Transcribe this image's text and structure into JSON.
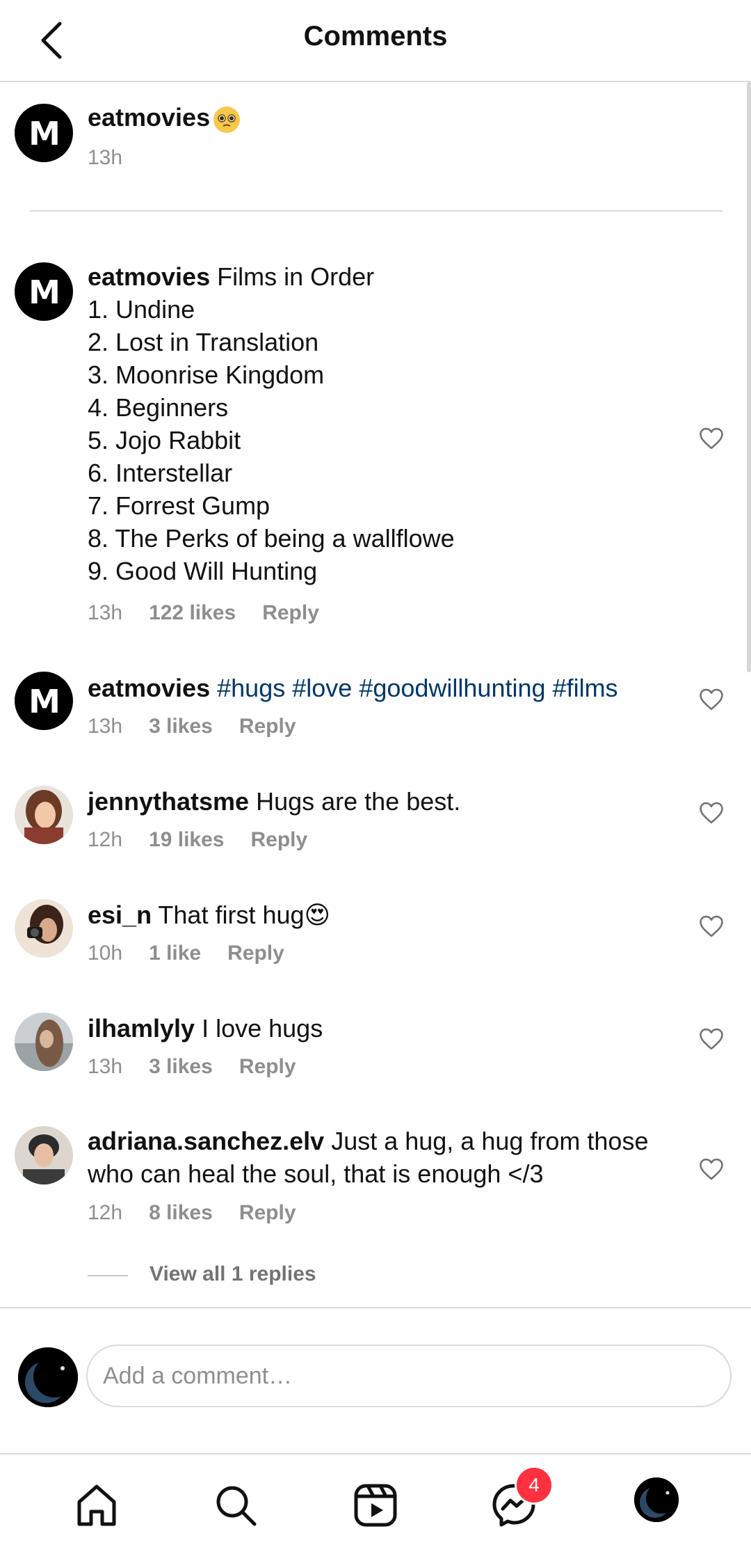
{
  "header": {
    "title": "Comments"
  },
  "caption": {
    "username": "eatmovies",
    "emoji": "🥺",
    "time": "13h"
  },
  "comments": [
    {
      "username": "eatmovies",
      "text": "Films in Order",
      "list": [
        "1. Undine",
        "2. Lost in Translation",
        "3. Moonrise Kingdom",
        "4. Beginners",
        "5. Jojo Rabbit",
        "6. Interstellar",
        "7. Forrest Gump",
        "8. The Perks of being a wallflowe",
        "9. Good Will Hunting"
      ],
      "time": "13h",
      "likes": "122 likes",
      "reply": "Reply"
    },
    {
      "username": "eatmovies",
      "hashtags": [
        "#hugs",
        "#love",
        "#goodwillhunting",
        "#films"
      ],
      "time": "13h",
      "likes": "3 likes",
      "reply": "Reply"
    },
    {
      "username": "jennythatsme",
      "text": "Hugs are the best.",
      "time": "12h",
      "likes": "19 likes",
      "reply": "Reply"
    },
    {
      "username": "esi_n",
      "text": "That first hug😍",
      "time": "10h",
      "likes": "1 like",
      "reply": "Reply"
    },
    {
      "username": "ilhamlyly",
      "text": "I love hugs",
      "time": "13h",
      "likes": "3 likes",
      "reply": "Reply"
    },
    {
      "username": "adriana.sanchez.elv",
      "text": "Just a hug, a hug from those who can heal the soul, that is enough </3",
      "time": "12h",
      "likes": "8 likes",
      "reply": "Reply",
      "view_replies": "View all 1 replies"
    }
  ],
  "composer": {
    "placeholder": "Add a comment…"
  },
  "nav": {
    "items": [
      "home-icon",
      "search-icon",
      "reels-icon",
      "messenger-icon",
      "profile-avatar"
    ],
    "messenger_badge": "4"
  },
  "colors": {
    "hashtag": "#00376b",
    "badge": "#ff3040",
    "muted": "#8e8e8e",
    "divider": "#dbdbdb"
  }
}
